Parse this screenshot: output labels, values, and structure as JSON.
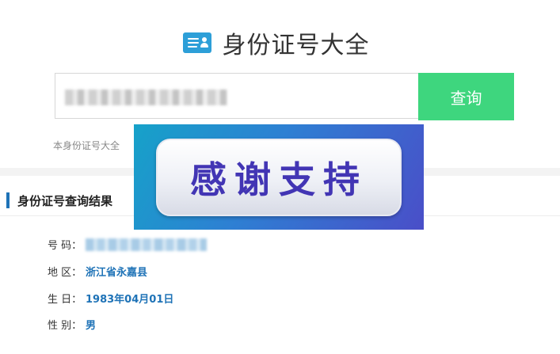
{
  "header": {
    "title": "身份证号大全",
    "icon": "id-card-icon"
  },
  "search": {
    "button_label": "查询",
    "value": ""
  },
  "note": {
    "text": "本身份证号大全"
  },
  "result": {
    "title": "身份证号查询结果",
    "rows": [
      {
        "label": "号 码：",
        "value": ""
      },
      {
        "label": "地 区：",
        "value": "浙江省永嘉县"
      },
      {
        "label": "生 日：",
        "value": "1983年04月01日"
      },
      {
        "label": "性 别：",
        "value": "男"
      }
    ]
  },
  "banner": {
    "text": "感谢支持"
  },
  "colors": {
    "accent_blue": "#1f73b7",
    "button_green": "#3ed67e",
    "logo_blue": "#2d9fd8"
  }
}
